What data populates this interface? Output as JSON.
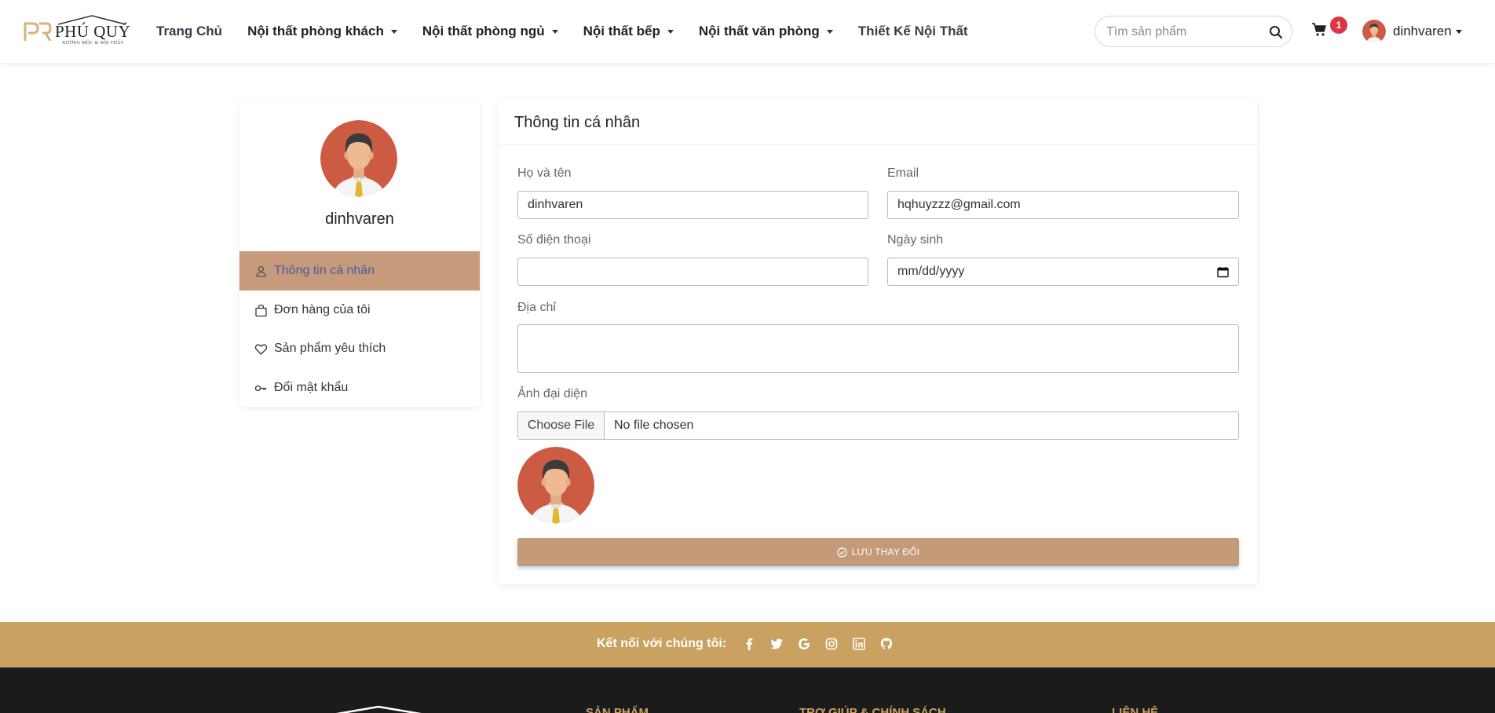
{
  "brand": {
    "name": "PHÚ QUÝ",
    "tagline": "XƯỞNG MỘC & NỘI THẤT",
    "logo_mark": "pq-logo-mark"
  },
  "nav": {
    "items": [
      {
        "label": "Trang Chủ",
        "dropdown": false
      },
      {
        "label": "Nội thất phòng khách",
        "dropdown": true
      },
      {
        "label": "Nội thất phòng ngủ",
        "dropdown": true
      },
      {
        "label": "Nội thất bếp",
        "dropdown": true
      },
      {
        "label": "Nội thất văn phòng",
        "dropdown": true
      },
      {
        "label": "Thiết Kế Nội Thất",
        "dropdown": false
      }
    ],
    "search_placeholder": "Tìm sản phẩm",
    "cart_count": "1",
    "username": "dinhvaren"
  },
  "sidebar": {
    "username": "dinhvaren",
    "items": [
      {
        "label": "Thông tin cá nhân",
        "icon": "user-icon",
        "active": true
      },
      {
        "label": "Đơn hàng của tôi",
        "icon": "bag-icon",
        "active": false
      },
      {
        "label": "Sản phẩm yêu thích",
        "icon": "heart-icon",
        "active": false
      },
      {
        "label": "Đổi mật khẩu",
        "icon": "key-icon",
        "active": false
      }
    ]
  },
  "profile": {
    "title": "Thông tin cá nhân",
    "fullname_label": "Họ và tên",
    "fullname_value": "dinhvaren",
    "email_label": "Email",
    "email_value": "hqhuyzzz@gmail.com",
    "phone_label": "Số điện thoại",
    "phone_value": "",
    "dob_label": "Ngày sinh",
    "dob_placeholder": "mm/dd/yyyy",
    "address_label": "Địa chỉ",
    "address_value": "",
    "avatar_label": "Ảnh đại diện",
    "file_button": "Choose File",
    "file_status": "No file chosen",
    "save_label": "LƯU THAY ĐỔI"
  },
  "social": {
    "label": "Kết nối với chúng tôi:",
    "icons": [
      "facebook-icon",
      "twitter-icon",
      "google-icon",
      "instagram-icon",
      "linkedin-icon",
      "github-icon"
    ]
  },
  "footer": {
    "col_products": "SẢN PHẨM",
    "col_support": "TRỢ GIÚP & CHÍNH SÁCH",
    "col_contact": "LIÊN HỆ"
  },
  "colors": {
    "accent": "#c49a78",
    "social_band": "#c9a261",
    "footer_bg": "#1b1b1b",
    "badge": "#dc3545",
    "avatar_bg": "#cd5b43"
  }
}
